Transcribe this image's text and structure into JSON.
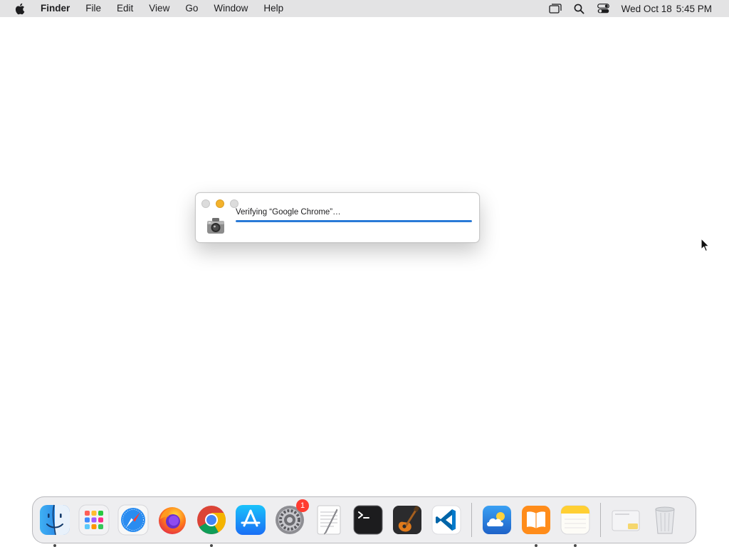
{
  "menubar": {
    "app_name": "Finder",
    "items": [
      "File",
      "Edit",
      "View",
      "Go",
      "Window",
      "Help"
    ],
    "clock": {
      "date": "Wed Oct 18",
      "time": "5:45 PM"
    }
  },
  "dialog": {
    "message": "Verifying “Google Chrome”…",
    "progress": 1.0,
    "progress_color": "#2a7ad7"
  },
  "dock": {
    "apps": [
      {
        "name": "Finder",
        "icon": "finder-icon",
        "running": true
      },
      {
        "name": "Launchpad",
        "icon": "launchpad-icon",
        "running": false
      },
      {
        "name": "Safari",
        "icon": "safari-icon",
        "running": false
      },
      {
        "name": "Firefox",
        "icon": "firefox-icon",
        "running": false
      },
      {
        "name": "Google Chrome",
        "icon": "chrome-icon",
        "running": true
      },
      {
        "name": "App Store",
        "icon": "app-store-icon",
        "running": false
      },
      {
        "name": "System Settings",
        "icon": "system-settings-icon",
        "running": false,
        "badge": "1"
      },
      {
        "name": "TextEdit",
        "icon": "textedit-icon",
        "running": false
      },
      {
        "name": "Terminal",
        "icon": "terminal-icon",
        "running": false
      },
      {
        "name": "GarageBand",
        "icon": "garageband-icon",
        "running": false
      },
      {
        "name": "Visual Studio Code",
        "icon": "vscode-icon",
        "running": false
      }
    ],
    "recents": [
      {
        "name": "Weather",
        "icon": "weather-icon",
        "running": false
      },
      {
        "name": "Books",
        "icon": "books-icon",
        "running": true
      },
      {
        "name": "Notes",
        "icon": "notes-icon",
        "running": true
      }
    ],
    "trailing": [
      {
        "name": "Downloads",
        "icon": "downloads-stack-icon"
      },
      {
        "name": "Trash",
        "icon": "trash-icon"
      }
    ]
  }
}
